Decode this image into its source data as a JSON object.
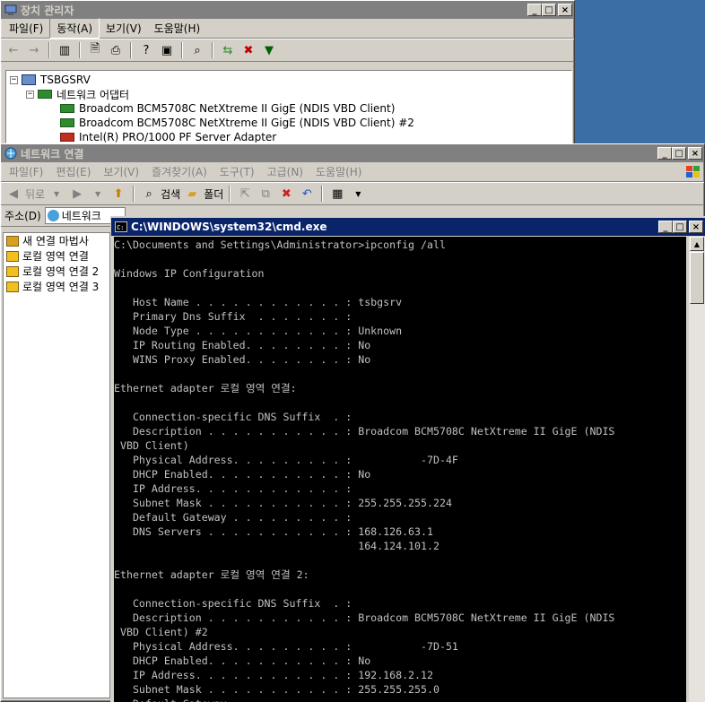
{
  "devmgr": {
    "title": "장치 관리자",
    "menus": [
      "파일(F)",
      "동작(A)",
      "보기(V)",
      "도움말(H)"
    ],
    "tree": {
      "root": "TSBGSRV",
      "category": "네트워크 어댑터",
      "devices": [
        "Broadcom BCM5708C NetXtreme II GigE (NDIS VBD Client)",
        "Broadcom BCM5708C NetXtreme II GigE (NDIS VBD Client) #2",
        "Intel(R) PRO/1000 PF Server Adapter"
      ]
    }
  },
  "netwin": {
    "title": "네트워크 연결",
    "menus": [
      "파일(F)",
      "편집(E)",
      "보기(V)",
      "즐겨찾기(A)",
      "도구(T)",
      "고급(N)",
      "도움말(H)"
    ],
    "toolbar": {
      "back": "뒤로",
      "search": "검색",
      "folders": "폴더"
    },
    "address_label": "주소(D)",
    "address_value": "네트워크",
    "items": [
      "새 연결 마법사",
      "로컬 영역 연결",
      "로컬 영역 연결 2",
      "로컬 영역 연결 3"
    ]
  },
  "cmd": {
    "title": "C:\\WINDOWS\\system32\\cmd.exe",
    "lines": [
      "C:\\Documents and Settings\\Administrator>ipconfig /all",
      "",
      "Windows IP Configuration",
      "",
      "   Host Name . . . . . . . . . . . . : tsbgsrv",
      "   Primary Dns Suffix  . . . . . . . :",
      "   Node Type . . . . . . . . . . . . : Unknown",
      "   IP Routing Enabled. . . . . . . . : No",
      "   WINS Proxy Enabled. . . . . . . . : No",
      "",
      "Ethernet adapter 로컬 영역 연결:",
      "",
      "   Connection-specific DNS Suffix  . :",
      "   Description . . . . . . . . . . . : Broadcom BCM5708C NetXtreme II GigE (NDIS",
      " VBD Client)",
      "   Physical Address. . . . . . . . . :           -7D-4F",
      "   DHCP Enabled. . . . . . . . . . . : No",
      "   IP Address. . . . . . . . . . . . :",
      "   Subnet Mask . . . . . . . . . . . : 255.255.255.224",
      "   Default Gateway . . . . . . . . . :",
      "   DNS Servers . . . . . . . . . . . : 168.126.63.1",
      "                                       164.124.101.2",
      "",
      "Ethernet adapter 로컬 영역 연결 2:",
      "",
      "   Connection-specific DNS Suffix  . :",
      "   Description . . . . . . . . . . . : Broadcom BCM5708C NetXtreme II GigE (NDIS",
      " VBD Client) #2",
      "   Physical Address. . . . . . . . . :           -7D-51",
      "   DHCP Enabled. . . . . . . . . . . : No",
      "   IP Address. . . . . . . . . . . . : 192.168.2.12",
      "   Subnet Mask . . . . . . . . . . . : 255.255.255.0",
      "   Default Gateway . . . . . . . . . :"
    ]
  }
}
